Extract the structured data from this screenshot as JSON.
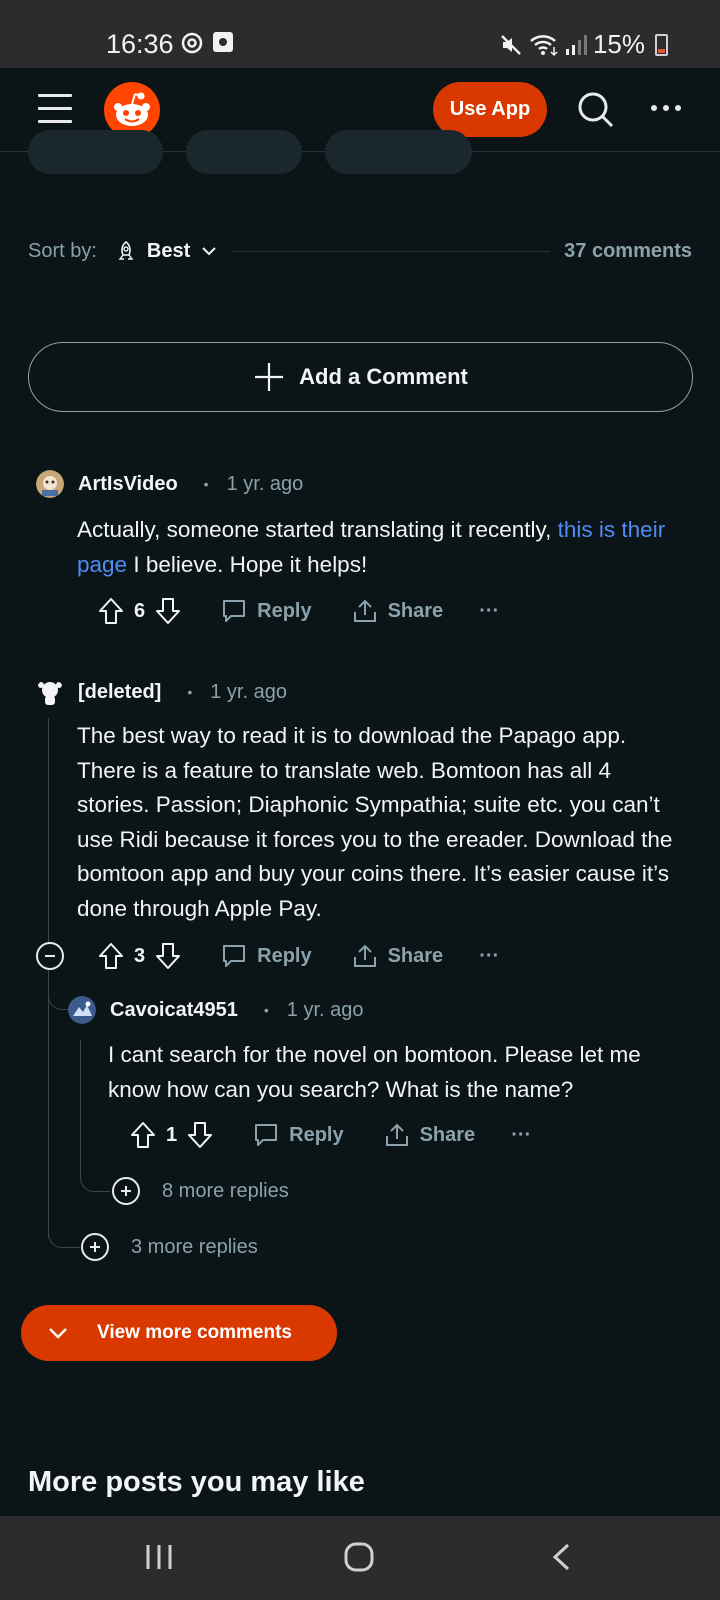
{
  "status_bar": {
    "time": "16:36",
    "battery": "15%"
  },
  "header": {
    "use_app": "Use App"
  },
  "sort": {
    "label": "Sort by:",
    "value": "Best",
    "count": "37 comments"
  },
  "add_comment": "Add a Comment",
  "comments": [
    {
      "author": "ArtIsVideo",
      "time": "1 yr. ago",
      "text_before": "Actually, someone started translating it recently, ",
      "link_text": "this is their page",
      "text_after": " I believe. Hope it helps!",
      "votes": "6"
    },
    {
      "author": "[deleted]",
      "time": "1 yr. ago",
      "text": "The best way to read it is to download the Papago app. There is a feature to translate web. Bomtoon has all 4 stories. Passion; Diaphonic Sympathia; suite etc. you can’t use Ridi because it forces you to the ereader. Download the bomtoon app and buy your coins there. It’s easier cause it’s done through Apple Pay.",
      "votes": "3"
    },
    {
      "author": "Cavoicat4951",
      "time": "1 yr. ago",
      "text": "I cant search for the novel on bomtoon. Please let me know how can you search? What is the name?",
      "votes": "1"
    }
  ],
  "actions": {
    "reply": "Reply",
    "share": "Share",
    "more": "···"
  },
  "more_replies_nested": "8 more replies",
  "more_replies_top": "3 more replies",
  "view_more": "View more comments",
  "more_posts": "More posts you may like"
}
